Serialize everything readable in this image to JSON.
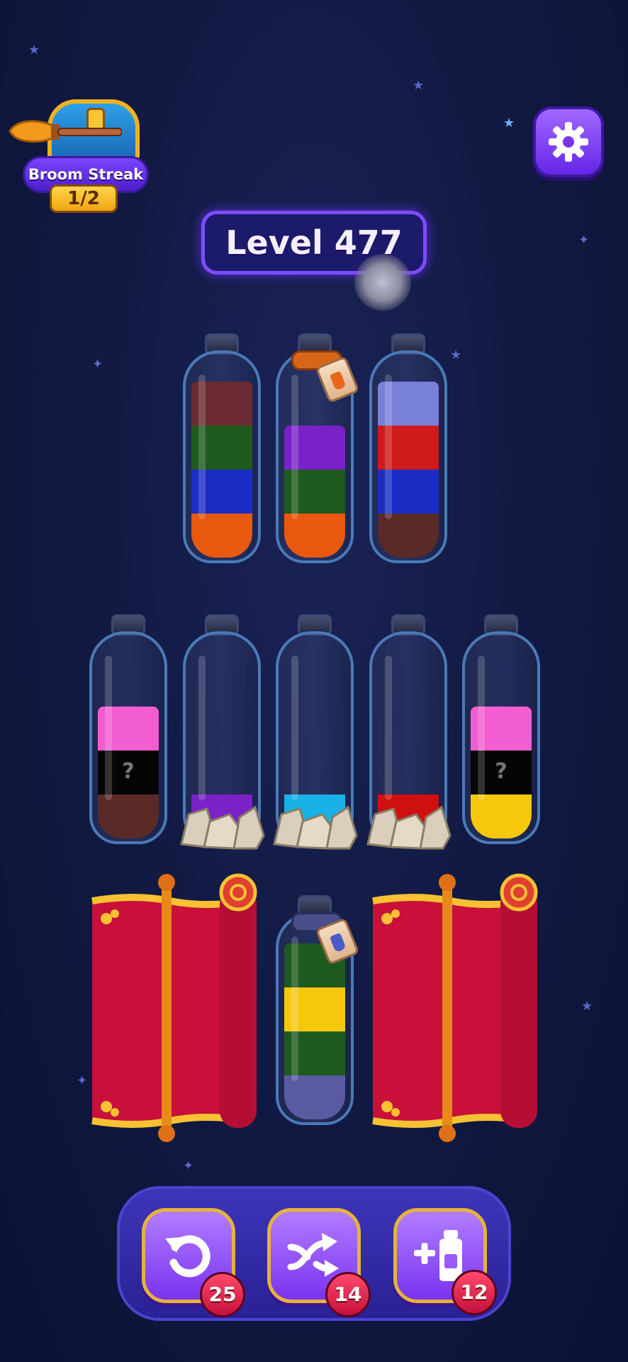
{
  "broom_streak": {
    "label": "Broom Streak",
    "count": "1/2"
  },
  "level": {
    "label": "Level 477"
  },
  "bottles_row1": [
    {
      "colors": [
        "#6a2a30",
        "#1e5a1e",
        "#1a2ec6",
        "#e8580e"
      ],
      "locked": false
    },
    {
      "colors": [
        "#7a22c8",
        "#1e5a1e",
        "#e8580e"
      ],
      "locked": true,
      "lock_color": "orange"
    },
    {
      "colors": [
        "#7880d8",
        "#cf1a1a",
        "#1a2ec6",
        "#5a2a26"
      ],
      "locked": false
    }
  ],
  "bottles_row2": [
    {
      "colors": [
        "#f25dd0",
        "#050505",
        "#5a2a26"
      ],
      "hidden": [
        1
      ],
      "rocks": false
    },
    {
      "colors": [
        "#7a22c8"
      ],
      "hidden": [],
      "rocks": true
    },
    {
      "colors": [
        "#1ab0e8"
      ],
      "hidden": [],
      "rocks": true
    },
    {
      "colors": [
        "#cf1010"
      ],
      "hidden": [],
      "rocks": true
    },
    {
      "colors": [
        "#f25dd0",
        "#050505",
        "#f5c80e"
      ],
      "hidden": [
        1
      ],
      "rocks": false
    }
  ],
  "bottle_row3": {
    "colors": [
      "#1e5a1e",
      "#f5c80e",
      "#1e5a1e",
      "#5a5aa0"
    ],
    "locked": true,
    "lock_color": "blue"
  },
  "hidden_symbol": "?",
  "powerups": [
    {
      "name": "undo",
      "icon": "undo-icon",
      "count": "25"
    },
    {
      "name": "shuffle",
      "icon": "shuffle-icon",
      "count": "14"
    },
    {
      "name": "add-bottle",
      "icon": "add-bottle-icon",
      "count": "12"
    }
  ],
  "colors": {
    "accent": "#7d4cff",
    "gold": "#f0b21e",
    "curtain": "#c8103a"
  }
}
